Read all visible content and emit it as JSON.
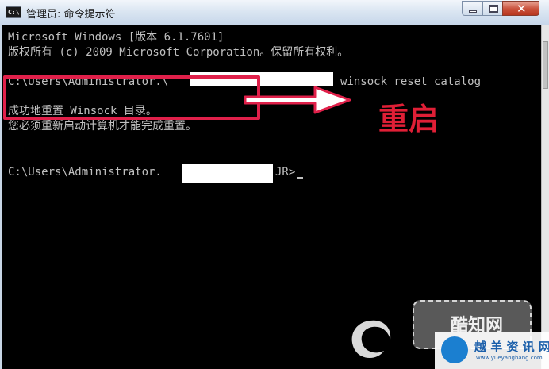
{
  "window": {
    "title": "管理员: 命令提示符",
    "icon": "cmd-icon",
    "controls": {
      "minimize_icon": "minimize-icon",
      "maximize_icon": "maximize-icon",
      "close_icon": "close-icon"
    }
  },
  "console": {
    "lines": [
      "Microsoft Windows [版本 6.1.7601]",
      "版权所有 (c) 2009 Microsoft Corporation。保留所有权利。",
      "",
      "C:\\Users\\Administrator.\\",
      "winsock reset catalog",
      "成功地重置 Winsock 目录。",
      "您必须重新启动计算机才能完成重置。",
      "C:\\Users\\Administrator.",
      "JR>"
    ],
    "colors": {
      "background": "#000000",
      "text": "#c0c0c0"
    }
  },
  "annotation": {
    "label": "重启",
    "color": "#e01f36",
    "box_color": "#e0204a",
    "arrow_icon": "arrow-right-icon"
  },
  "watermark": {
    "stamp_text": "酷知网",
    "logo_text": "越 羊 资 讯 网",
    "logo_url": "www.yueyangbang.com"
  }
}
